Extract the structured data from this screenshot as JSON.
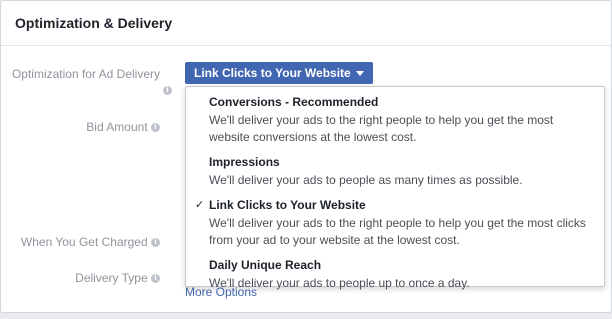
{
  "section": {
    "title": "Optimization & Delivery"
  },
  "labels": {
    "optimization": "Optimization for Ad Delivery",
    "bid_amount": "Bid Amount",
    "when_charged": "When You Get Charged",
    "delivery_type": "Delivery Type"
  },
  "info_icon": {
    "glyph": "i",
    "icon": "info-icon"
  },
  "optimization_button": {
    "label": "Link Clicks to Your Website",
    "icon": "caret-down-icon",
    "color": "#4267b2"
  },
  "more_options": {
    "label": "More Options"
  },
  "dropdown": {
    "check_glyph": "✓",
    "options": [
      {
        "title": "Conversions - Recommended",
        "description": "We'll deliver your ads to the right people to help you get the most website conversions at the lowest cost.",
        "selected": false
      },
      {
        "title": "Impressions",
        "description": "We'll deliver your ads to people as many times as possible.",
        "selected": false
      },
      {
        "title": "Link Clicks to Your Website",
        "description": "We'll deliver your ads to the right people to help you get the most clicks from your ad to your website at the lowest cost.",
        "selected": true
      },
      {
        "title": "Daily Unique Reach",
        "description": "We'll deliver your ads to people up to once a day.",
        "selected": false
      }
    ]
  }
}
